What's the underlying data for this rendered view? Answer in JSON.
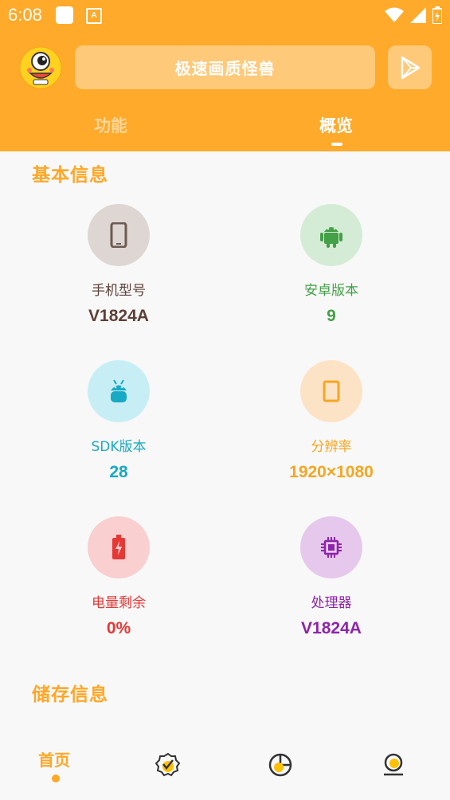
{
  "status_bar": {
    "time": "6:08",
    "notif_a": "A"
  },
  "header": {
    "title": "极速画质怪兽"
  },
  "tabs": [
    {
      "label": "功能"
    },
    {
      "label": "概览"
    }
  ],
  "sections": {
    "basic_info": "基本信息",
    "storage_info": "储存信息"
  },
  "cards": [
    {
      "label": "手机型号",
      "value": "V1824A",
      "icon": "phone-icon",
      "label_color": "#5d4037",
      "value_color": "#5d4037",
      "bg": "#ddd6d3"
    },
    {
      "label": "安卓版本",
      "value": "9",
      "icon": "android-icon",
      "label_color": "#43a047",
      "value_color": "#43a047",
      "bg": "#d4ecd5"
    },
    {
      "label": "SDK版本",
      "value": "28",
      "icon": "sdk-icon",
      "label_color": "#18a9c4",
      "value_color": "#18a9c4",
      "bg": "#c8eef5"
    },
    {
      "label": "分辨率",
      "value": "1920×1080",
      "icon": "screen-icon",
      "label_color": "#f5a623",
      "value_color": "#f5a623",
      "bg": "#fde3c6"
    },
    {
      "label": "电量剩余",
      "value": "0%",
      "icon": "battery-icon",
      "label_color": "#e53935",
      "value_color": "#e53935",
      "bg": "#f9cfcf"
    },
    {
      "label": "处理器",
      "value": "V1824A",
      "icon": "cpu-icon",
      "label_color": "#8e24aa",
      "value_color": "#8e24aa",
      "bg": "#e6c8ec"
    }
  ],
  "nav": {
    "home_label": "首页"
  }
}
